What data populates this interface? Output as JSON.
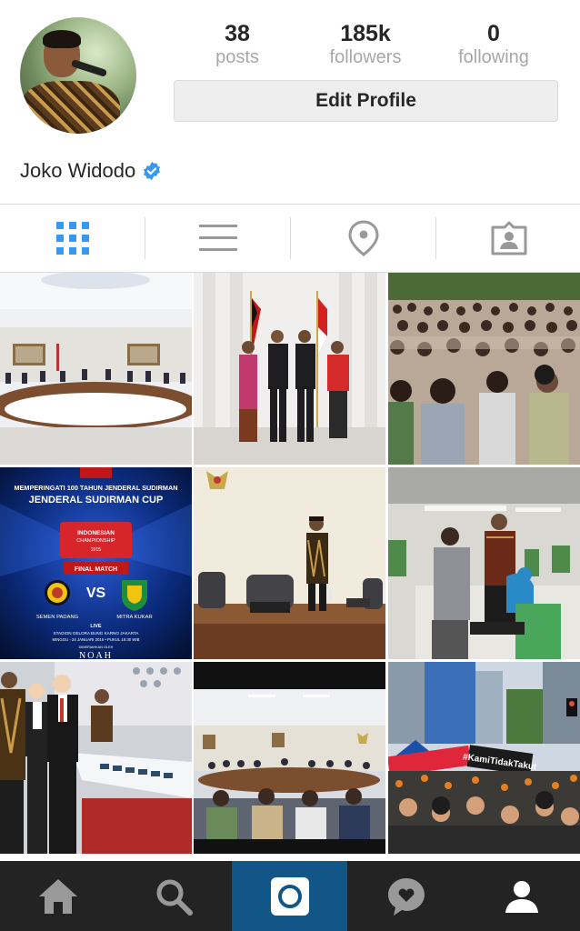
{
  "profile": {
    "name": "Joko Widodo",
    "verified": true,
    "stats": [
      {
        "value": "38",
        "label": "posts"
      },
      {
        "value": "185k",
        "label": "followers"
      },
      {
        "value": "0",
        "label": "following"
      }
    ],
    "edit_label": "Edit Profile"
  },
  "tabs": [
    {
      "name": "grid-view",
      "icon": "grid-icon",
      "active": true
    },
    {
      "name": "list-view",
      "icon": "list-icon",
      "active": false
    },
    {
      "name": "photo-map",
      "icon": "map-pin-icon",
      "active": false
    },
    {
      "name": "tagged-photos",
      "icon": "tagged-person-icon",
      "active": false
    }
  ],
  "posts": [
    {
      "scene": "cabinet-meeting-room"
    },
    {
      "scene": "flags-handshake"
    },
    {
      "scene": "crowd"
    },
    {
      "scene": "jenderal-sudirman-cup-poster",
      "poster": {
        "headline": "MEMPERINGATI 100 TAHUN JENDERAL SUDIRMAN",
        "title": "JENDERAL SUDIRMAN CUP",
        "badge_line1": "INDONESIAN",
        "badge_line2": "CHAMPIONSHIP",
        "badge_year": "2015",
        "ribbon": "FINAL MATCH",
        "vs": "VS",
        "team1": "SEMEN PADANG",
        "team2": "MITRA KUKAR",
        "live": "LIVE",
        "venue": "STADION GELORA BUNG KARNO JAKARTA",
        "date": "MINGGU - 24 JANUARI 2016 • PUKUL 18.30 WIB",
        "sponsor_label": "DIMERIAHKAN OLEH",
        "sponsor": "NOAH"
      }
    },
    {
      "scene": "office-standing"
    },
    {
      "scene": "factory-visit"
    },
    {
      "scene": "train-model"
    },
    {
      "scene": "meeting-table"
    },
    {
      "scene": "street-rally",
      "sign_text": "#KamiTidakTakut"
    }
  ],
  "bottom_nav": [
    {
      "name": "home",
      "icon": "home-icon",
      "active": false
    },
    {
      "name": "search",
      "icon": "search-icon",
      "active": false
    },
    {
      "name": "camera",
      "icon": "camera-icon",
      "active": true
    },
    {
      "name": "activity",
      "icon": "heart-bubble-icon",
      "active": false
    },
    {
      "name": "profile",
      "icon": "person-icon",
      "active": false
    }
  ],
  "colors": {
    "active_tab": "#3897f0",
    "inactive_icon": "#999999",
    "verified": "#3897f0",
    "bottom_bar": "#232323",
    "bottom_active": "#125688"
  }
}
